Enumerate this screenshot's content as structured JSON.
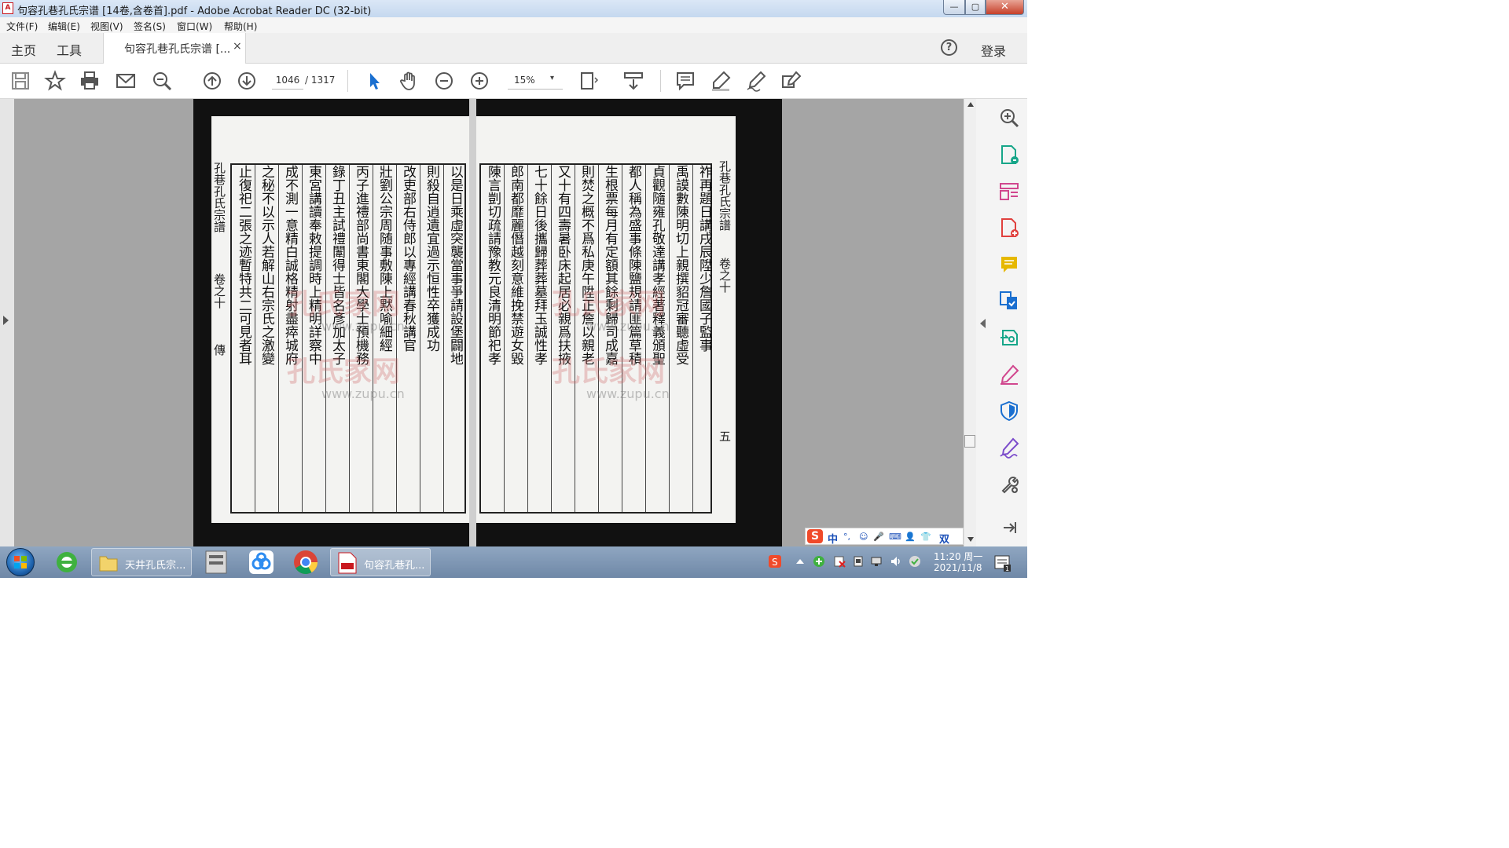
{
  "window": {
    "title": "句容孔巷孔氏宗谱 [14卷,含卷首].pdf - Adobe Acrobat Reader DC (32-bit)",
    "app_icon_glyph": "A",
    "minimize_glyph": "—",
    "maximize_glyph": "▢",
    "close_glyph": "✕"
  },
  "menu": {
    "items": [
      "文件(F)",
      "编辑(E)",
      "视图(V)",
      "签名(S)",
      "窗口(W)",
      "帮助(H)"
    ]
  },
  "tabs": {
    "home": "主页",
    "tools": "工具",
    "document": "句容孔巷孔氏宗谱 [...",
    "close_glyph": "×",
    "help_glyph": "?",
    "login": "登录"
  },
  "toolbar": {
    "icons": [
      "save-icon",
      "bookmark-star-icon",
      "print-icon",
      "email-icon",
      "search-zoom-icon",
      "page-up-icon",
      "page-down-icon",
      "select-cursor-icon",
      "hand-icon",
      "zoom-out-icon",
      "zoom-in-icon",
      "fit-page-icon",
      "scroll-mode-icon",
      "comment-icon",
      "highlight-pen-icon",
      "sign-icon",
      "edit-icon"
    ],
    "page_current": "1046",
    "page_total": "/ 1317",
    "zoom": "15%",
    "zoom_arrow": "▾"
  },
  "document": {
    "left_header_1": "孔巷孔氏宗譜",
    "left_header_2": "卷之十",
    "left_header_3": "傳",
    "right_header_1": "孔巷孔氏宗譜",
    "right_header_2": "卷之十",
    "right_header_3": "五",
    "left_columns": [
      "以是日乘虛突襲當事爭請設堡闢地",
      "則殺自逍遺宜過示恒性卒獲成功",
      "改吏部右侍郎以專經講春秋講官",
      "壯劉公宗周随事敷陳上黙喻細經",
      "丙子進禮部尚書東閣大學士預機務",
      "錄丁丑主試禮闈得士皆名彥加太子",
      "東宮講讀奉敕提調時上精明詳察中",
      "成不測一意精白誠格精射盡瘁城府",
      "之秘不以示人若解山右宗氏之激變",
      "止復祀二張之迹暫特共二可見者耳"
    ],
    "right_columns": [
      "祚再題日講戌辰陞少詹國子監事",
      "禹謨數陳明切上親撰貂冠審聽虛受",
      "貞觀隨雍孔敬達講孝經著釋義頒聖",
      "都人稱為盛事條陳鹽規請匪篇草積",
      "生根票每月有定額其餘剩歸司成嘉",
      "則焚之概不爲私庚午陞正詹以親老",
      "又十有四壽暑卧床起居必親爲扶掖",
      "七十餘日後攜歸葬葬墓拜玉誠性孝",
      "郎南都靡麗僭越刻意維挽禁遊女毀",
      "陳言剴切疏請豫教元良清明節祀孝"
    ],
    "watermark_text": "孔氏家网",
    "watermark_url": "www.zupu.cn"
  },
  "right_panel": {
    "tools": [
      "zoom-tool-icon",
      "export-pdf-icon",
      "organize-pages-icon",
      "create-pdf-icon",
      "comment-tool-icon",
      "combine-files-icon",
      "send-for-review-icon",
      "fill-sign-icon",
      "protect-icon",
      "signature-icon",
      "more-tools-icon",
      "exit-panel-icon"
    ]
  },
  "ime": {
    "logo": "S",
    "lang": "中",
    "items": [
      "°,",
      "☺",
      "🎤",
      "⌨",
      "👤",
      "👕"
    ],
    "mode": "双"
  },
  "taskbar": {
    "tasks": [
      {
        "label": "天井孔氏宗..."
      },
      {
        "label": "句容孔巷孔..."
      }
    ],
    "clock_time": "11:20 周一",
    "clock_date": "2021/11/8"
  },
  "colors": {
    "accent_blue": "#1a6fd0",
    "acrobat_red": "#c9181f",
    "tool_pink": "#d1478e",
    "tool_green": "#17a689",
    "tool_yellow": "#e6b800",
    "tool_purple": "#7c4dcb"
  }
}
